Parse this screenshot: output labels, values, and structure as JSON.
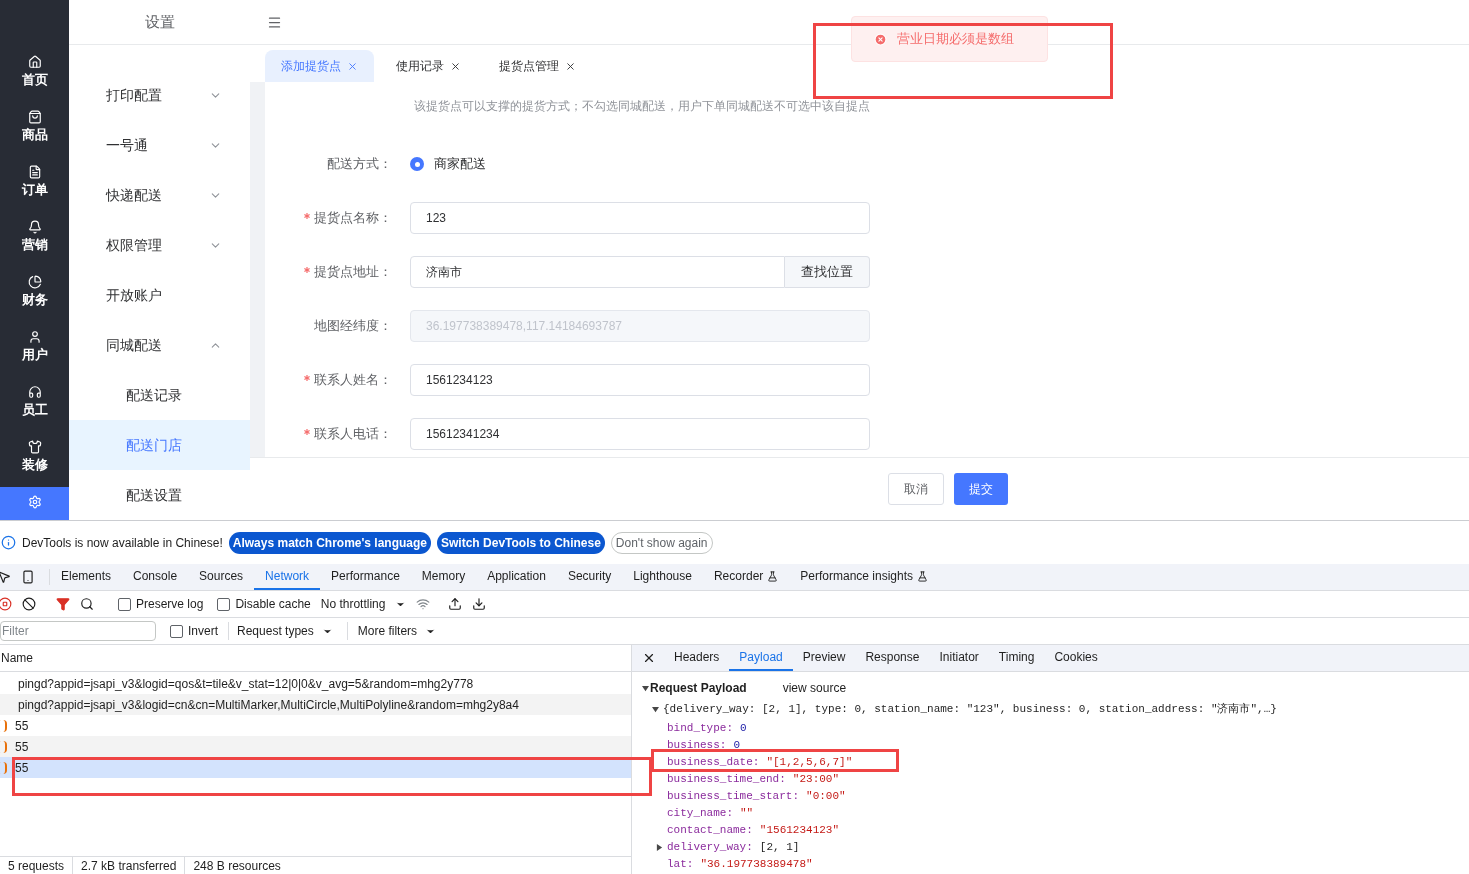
{
  "nav": [
    {
      "label": "首页",
      "selected": false
    },
    {
      "label": "商品",
      "selected": false
    },
    {
      "label": "订单",
      "selected": false
    },
    {
      "label": "营销",
      "selected": false
    },
    {
      "label": "财务",
      "selected": false
    },
    {
      "label": "用户",
      "selected": false
    },
    {
      "label": "员工",
      "selected": false
    },
    {
      "label": "装修",
      "selected": false
    },
    {
      "selected": true
    }
  ],
  "submenu": {
    "title": "设置",
    "items": [
      {
        "label": "打印配置",
        "kind": "group",
        "expanded": false
      },
      {
        "label": "一号通",
        "kind": "group",
        "expanded": false
      },
      {
        "label": "快递配送",
        "kind": "group",
        "expanded": false
      },
      {
        "label": "权限管理",
        "kind": "group",
        "expanded": false
      },
      {
        "label": "开放账户",
        "kind": "link"
      },
      {
        "label": "同城配送",
        "kind": "group",
        "expanded": true,
        "children": [
          {
            "label": "配送记录",
            "selected": false
          },
          {
            "label": "配送门店",
            "selected": true
          },
          {
            "label": "配送设置",
            "selected": false
          }
        ]
      }
    ]
  },
  "tabs": [
    {
      "label": "添加提货点",
      "selected": true
    },
    {
      "label": "使用记录",
      "selected": false
    },
    {
      "label": "提货点管理",
      "selected": false
    }
  ],
  "toast": {
    "message": "营业日期必须是数组"
  },
  "form": {
    "hint": "该提货点可以支撑的提货方式；不勾选同城配送，用户下单同城配送不可选中该自提点",
    "fields": [
      {
        "kind": "radio",
        "label": "配送方式：",
        "required": false,
        "option": "商家配送",
        "checked": true
      },
      {
        "kind": "text",
        "label": "提货点名称：",
        "required": true,
        "value": "123",
        "disabled": false
      },
      {
        "kind": "search",
        "label": "提货点地址：",
        "required": true,
        "value": "济南市",
        "button": "查找位置",
        "disabled": false
      },
      {
        "kind": "text",
        "label": "地图经纬度：",
        "required": false,
        "value": "36.197738389478,117.14184693787",
        "disabled": true
      },
      {
        "kind": "text",
        "label": "联系人姓名：",
        "required": true,
        "value": "1561234123",
        "disabled": false
      },
      {
        "kind": "text",
        "label": "联系人电话：",
        "required": true,
        "value": "15612341234",
        "disabled": false
      }
    ],
    "buttons": [
      {
        "label": "取消",
        "kind": "default"
      },
      {
        "label": "提交",
        "kind": "primary"
      }
    ]
  },
  "devtools": {
    "banner": {
      "text": "DevTools is now available in Chinese!",
      "buttons": [
        {
          "label": "Always match Chrome's language",
          "kind": "primary"
        },
        {
          "label": "Switch DevTools to Chinese",
          "kind": "primary"
        },
        {
          "label": "Don't show again",
          "kind": "outline"
        }
      ]
    },
    "tabs": [
      {
        "label": "Elements",
        "selected": false
      },
      {
        "label": "Console",
        "selected": false
      },
      {
        "label": "Sources",
        "selected": false
      },
      {
        "label": "Network",
        "selected": true
      },
      {
        "label": "Performance",
        "selected": false
      },
      {
        "label": "Memory",
        "selected": false
      },
      {
        "label": "Application",
        "selected": false
      },
      {
        "label": "Security",
        "selected": false
      },
      {
        "label": "Lighthouse",
        "selected": false
      },
      {
        "label": "Recorder",
        "selected": false,
        "experimental": true
      },
      {
        "label": "Performance insights",
        "selected": false,
        "experimental": true
      }
    ],
    "toolbar": {
      "preserve_log": {
        "label": "Preserve log",
        "checked": false
      },
      "disable_cache": {
        "label": "Disable cache",
        "checked": false
      },
      "throttling": "No throttling"
    },
    "filter": {
      "placeholder": "Filter",
      "invert": {
        "label": "Invert",
        "checked": false
      },
      "request_types": "Request types",
      "more_filters": "More filters"
    },
    "requests": {
      "column": "Name",
      "rows": [
        {
          "name": "pingd?appid=jsapi_v3&logid=qos&t=tile&v_stat=12|0|0&v_avg=5&random=mhg2y778",
          "kind": "ping",
          "selected": false
        },
        {
          "name": "pingd?appid=jsapi_v3&logid=cn&cn=MultiMarker,MultiCircle,MultiPolyline&random=mhg2y8a4",
          "kind": "ping",
          "selected": false
        },
        {
          "name": "55",
          "kind": "fetch",
          "selected": false
        },
        {
          "name": "55",
          "kind": "fetch",
          "selected": false
        },
        {
          "name": "55",
          "kind": "fetch",
          "selected": true
        }
      ]
    },
    "status": [
      "5 requests",
      "2.7 kB transferred",
      "248 B resources"
    ],
    "detail_tabs": [
      {
        "label": "Headers",
        "selected": false
      },
      {
        "label": "Payload",
        "selected": true
      },
      {
        "label": "Preview",
        "selected": false
      },
      {
        "label": "Response",
        "selected": false
      },
      {
        "label": "Initiator",
        "selected": false
      },
      {
        "label": "Timing",
        "selected": false
      },
      {
        "label": "Cookies",
        "selected": false
      }
    ],
    "payload": {
      "title": "Request Payload",
      "view_source": "view source",
      "summary": "{delivery_way: [2, 1], type: 0, station_name: \"123\", business: 0, station_address: \"济南市\",…}",
      "expanded": true,
      "properties": [
        {
          "key": "bind_type:",
          "value": "0",
          "kind": "number"
        },
        {
          "key": "business:",
          "value": "0",
          "kind": "number"
        },
        {
          "key": "business_date:",
          "value": "\"[1,2,5,6,7]\"",
          "kind": "string"
        },
        {
          "key": "business_time_end:",
          "value": "\"23:00\"",
          "kind": "string"
        },
        {
          "key": "business_time_start:",
          "value": "\"0:00\"",
          "kind": "string"
        },
        {
          "key": "city_name:",
          "value": "\"\"",
          "kind": "string"
        },
        {
          "key": "contact_name:",
          "value": "\"1561234123\"",
          "kind": "string"
        },
        {
          "key": "delivery_way:",
          "value": "[2, 1]",
          "kind": "array",
          "expanded": false
        },
        {
          "key": "lat:",
          "value": "\"36.197738389478\"",
          "kind": "string"
        }
      ]
    }
  }
}
